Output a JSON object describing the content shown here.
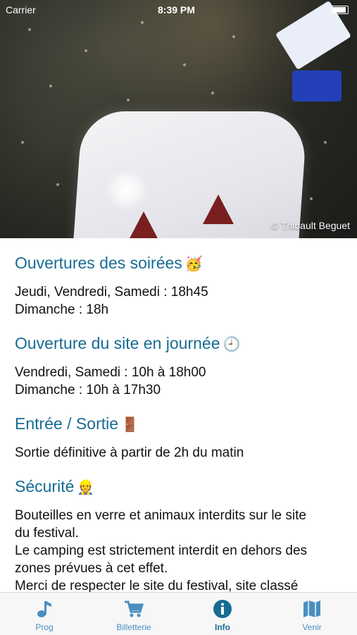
{
  "status_bar": {
    "carrier": "Carrier",
    "time": "8:39 PM"
  },
  "hero": {
    "credit": "© Thibault Beguet"
  },
  "sections": [
    {
      "title": "Ouvertures des soirées",
      "emoji": "🥳",
      "lines": [
        "Jeudi, Vendredi, Samedi : 18h45",
        "Dimanche : 18h"
      ]
    },
    {
      "title": "Ouverture du site en journée",
      "emoji": "🕘",
      "lines": [
        "Vendredi, Samedi : 10h à 18h00",
        "Dimanche : 10h à 17h30"
      ]
    },
    {
      "title": "Entrée / Sortie",
      "emoji": "🚪",
      "lines": [
        "Sortie définitive à partir de 2h du matin"
      ]
    },
    {
      "title": "Sécurité",
      "emoji": "👷",
      "lines": [
        "Bouteilles en verre et animaux interdits sur le site",
        "du festival.",
        "Le camping est strictement interdit en dehors des",
        "zones prévues à cet effet.",
        "Merci de respecter le site du festival, site classé"
      ]
    }
  ],
  "tabs": [
    {
      "label": "Prog",
      "icon": "music-note-icon",
      "active": false
    },
    {
      "label": "Billetterie",
      "icon": "cart-icon",
      "active": false
    },
    {
      "label": "Info",
      "icon": "info-icon",
      "active": true
    },
    {
      "label": "Venir",
      "icon": "map-icon",
      "active": false
    }
  ],
  "colors": {
    "heading": "#176c93",
    "tab_inactive": "#4a8fbf",
    "tab_active": "#176c93"
  }
}
